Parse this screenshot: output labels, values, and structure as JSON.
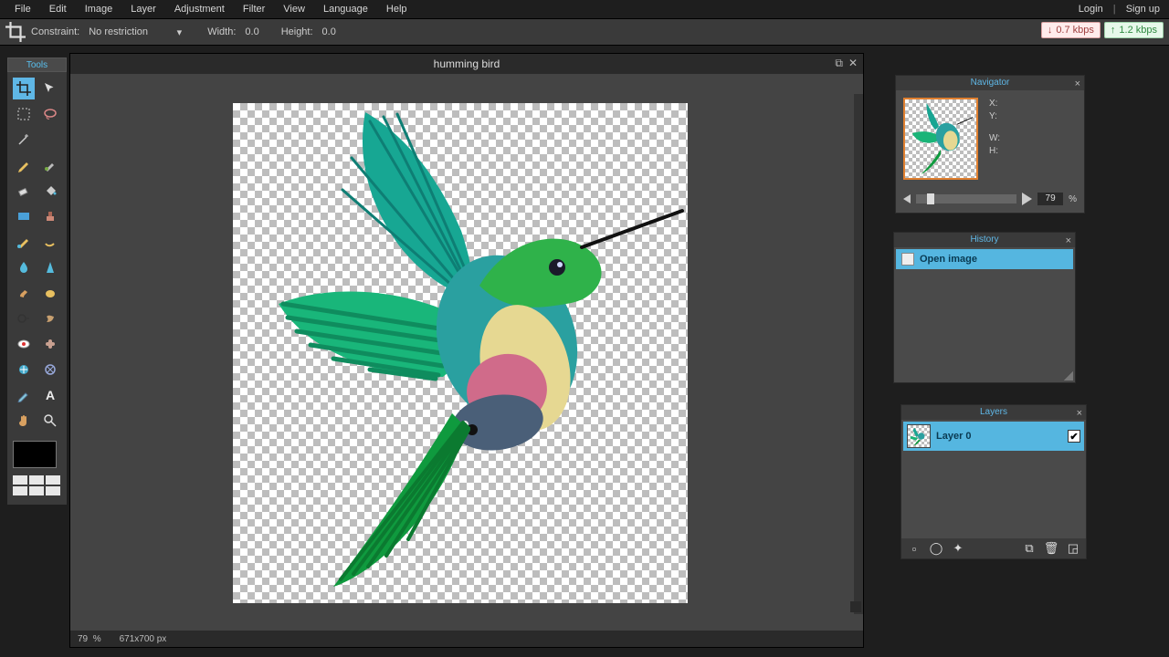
{
  "menu": {
    "items": [
      "File",
      "Edit",
      "Image",
      "Layer",
      "Adjustment",
      "Filter",
      "View",
      "Language",
      "Help"
    ],
    "login": "Login",
    "signup": "Sign up"
  },
  "options": {
    "constraint_label": "Constraint:",
    "constraint_value": "No restriction",
    "width_label": "Width:",
    "width_value": "0.0",
    "height_label": "Height:",
    "height_value": "0.0"
  },
  "net": {
    "down": "0.7 kbps",
    "up": "1.2 kbps"
  },
  "tools_title": "Tools",
  "document": {
    "title": "humming bird",
    "zoom": "79",
    "zoom_unit": "%",
    "dims": "671x700 px"
  },
  "navigator": {
    "title": "Navigator",
    "x": "X:",
    "y": "Y:",
    "w": "W:",
    "h": "H:",
    "zoom": "79",
    "unit": "%"
  },
  "history": {
    "title": "History",
    "items": [
      "Open image"
    ]
  },
  "layers": {
    "title": "Layers",
    "items": [
      {
        "name": "Layer 0",
        "visible": true
      }
    ]
  }
}
